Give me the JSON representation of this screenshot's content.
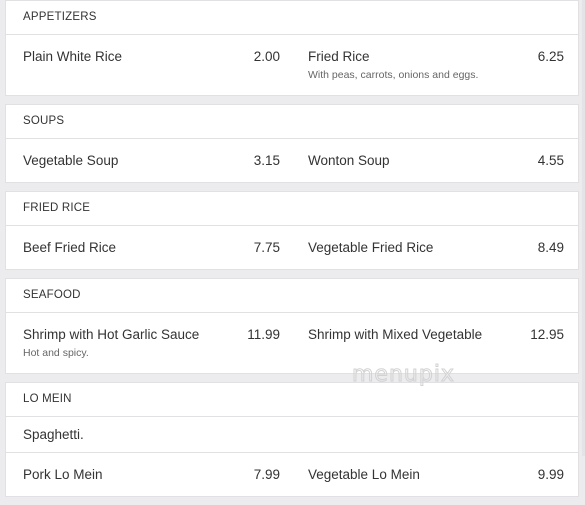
{
  "sections": [
    {
      "title": "APPETIZERS",
      "rows": [
        [
          {
            "name": "Plain White Rice",
            "price": "2.00"
          },
          {
            "name": "Fried Rice",
            "price": "6.25",
            "desc": "With peas, carrots, onions and eggs."
          }
        ]
      ]
    },
    {
      "title": "SOUPS",
      "rows": [
        [
          {
            "name": "Vegetable Soup",
            "price": "3.15"
          },
          {
            "name": "Wonton Soup",
            "price": "4.55"
          }
        ]
      ]
    },
    {
      "title": "FRIED RICE",
      "rows": [
        [
          {
            "name": "Beef Fried Rice",
            "price": "7.75"
          },
          {
            "name": "Vegetable Fried Rice",
            "price": "8.49"
          }
        ]
      ]
    },
    {
      "title": "SEAFOOD",
      "rows": [
        [
          {
            "name": "Shrimp with Hot Garlic Sauce",
            "price": "11.99",
            "desc": "Hot and spicy."
          },
          {
            "name": "Shrimp with Mixed Vegetable",
            "price": "12.95"
          }
        ]
      ]
    },
    {
      "title": "LO MEIN",
      "note": "Spaghetti.",
      "rows": [
        [
          {
            "name": "Pork Lo Mein",
            "price": "7.99"
          },
          {
            "name": "Vegetable Lo Mein",
            "price": "9.99"
          }
        ]
      ]
    }
  ],
  "watermark": "menupix"
}
